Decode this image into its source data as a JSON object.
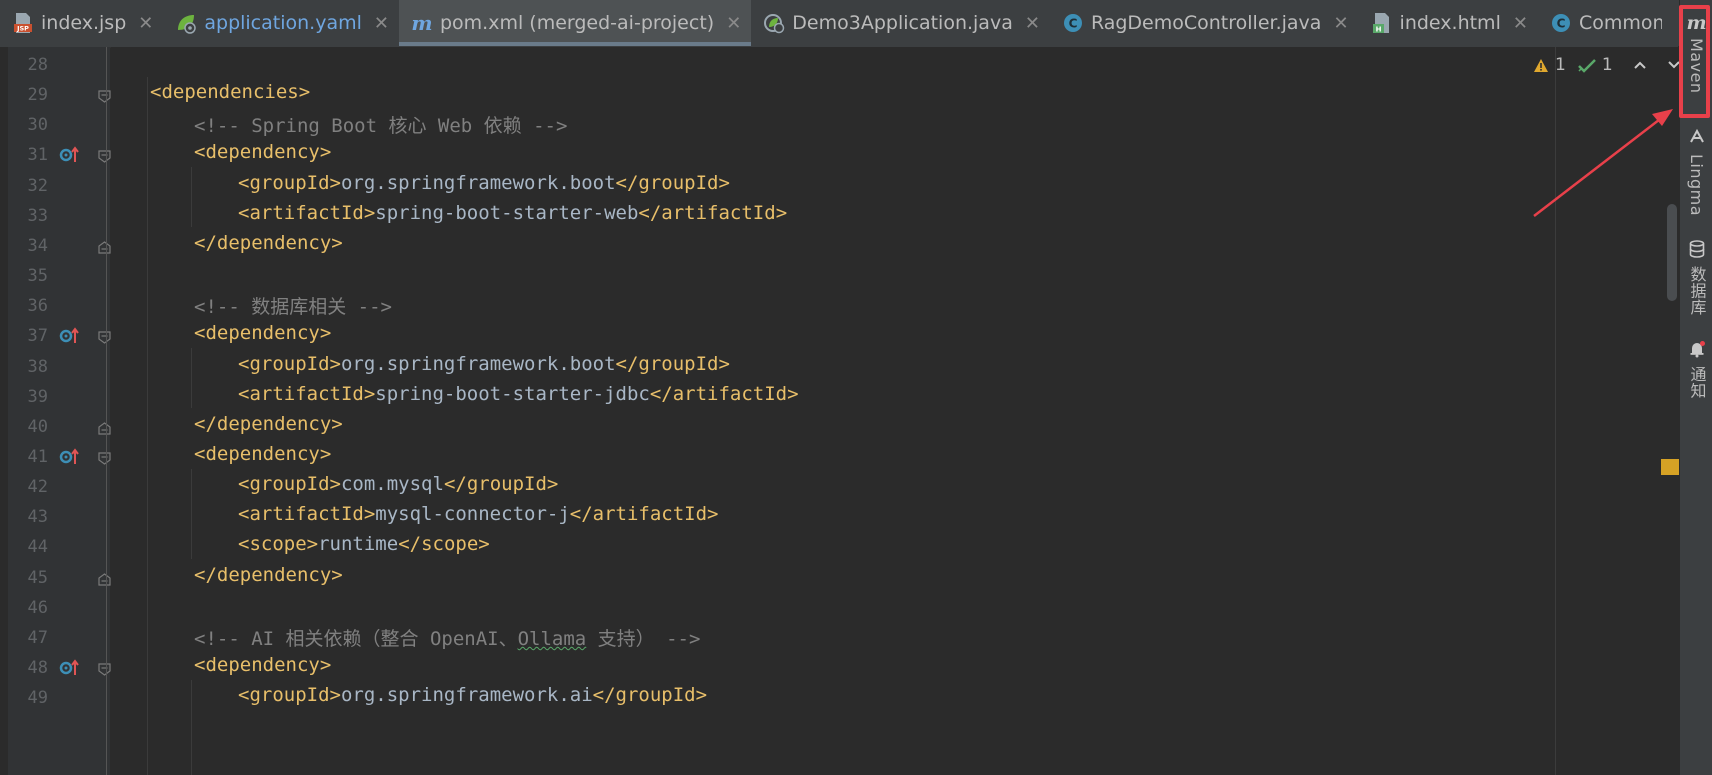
{
  "tabs": [
    {
      "label": "index.jsp",
      "icon": "jsp-file-icon",
      "active": false,
      "blue": false
    },
    {
      "label": "application.yaml",
      "icon": "spring-yaml-icon",
      "active": false,
      "blue": true
    },
    {
      "label": "pom.xml (merged-ai-project)",
      "icon": "maven-m-icon",
      "active": true,
      "blue": false
    },
    {
      "label": "Demo3Application.java",
      "icon": "spring-boot-app-icon",
      "active": false,
      "blue": false
    },
    {
      "label": "RagDemoController.java",
      "icon": "java-class-icon",
      "active": false,
      "blue": false
    },
    {
      "label": "index.html",
      "icon": "html-file-icon",
      "active": false,
      "blue": false
    },
    {
      "label": "CommonConf",
      "icon": "java-class-icon",
      "active": false,
      "blue": false
    }
  ],
  "tab_close_glyph": "✕",
  "tab_overflow_glyph": "⌄",
  "toolstrip": {
    "maven": "Maven",
    "lingma": "Lingma",
    "database": "数据库",
    "notifications": "通知"
  },
  "inspections": {
    "warnings": "1",
    "ok": "1"
  },
  "lines": [
    {
      "n": "28",
      "indent": 0,
      "kind": "blank",
      "text": ""
    },
    {
      "n": "29",
      "indent": 0,
      "kind": "open",
      "tag": "dependencies",
      "fold": "open"
    },
    {
      "n": "30",
      "indent": 1,
      "kind": "comment",
      "text": "<!-- Spring Boot 核心 Web 依赖 -->"
    },
    {
      "n": "31",
      "indent": 1,
      "kind": "open",
      "tag": "dependency",
      "fold": "open",
      "marker": true
    },
    {
      "n": "32",
      "indent": 2,
      "kind": "elem",
      "tag": "groupId",
      "text": "org.springframework.boot"
    },
    {
      "n": "33",
      "indent": 2,
      "kind": "elem",
      "tag": "artifactId",
      "text": "spring-boot-starter-web"
    },
    {
      "n": "34",
      "indent": 1,
      "kind": "close",
      "tag": "dependency",
      "fold": "close"
    },
    {
      "n": "35",
      "indent": 0,
      "kind": "blank",
      "text": ""
    },
    {
      "n": "36",
      "indent": 1,
      "kind": "comment",
      "text": "<!-- 数据库相关 -->"
    },
    {
      "n": "37",
      "indent": 1,
      "kind": "open",
      "tag": "dependency",
      "fold": "open",
      "marker": true
    },
    {
      "n": "38",
      "indent": 2,
      "kind": "elem",
      "tag": "groupId",
      "text": "org.springframework.boot"
    },
    {
      "n": "39",
      "indent": 2,
      "kind": "elem",
      "tag": "artifactId",
      "text": "spring-boot-starter-jdbc"
    },
    {
      "n": "40",
      "indent": 1,
      "kind": "close",
      "tag": "dependency",
      "fold": "close"
    },
    {
      "n": "41",
      "indent": 1,
      "kind": "open",
      "tag": "dependency",
      "fold": "open",
      "marker": true
    },
    {
      "n": "42",
      "indent": 2,
      "kind": "elem",
      "tag": "groupId",
      "text": "com.mysql"
    },
    {
      "n": "43",
      "indent": 2,
      "kind": "elem",
      "tag": "artifactId",
      "text": "mysql-connector-j"
    },
    {
      "n": "44",
      "indent": 2,
      "kind": "elem",
      "tag": "scope",
      "text": "runtime"
    },
    {
      "n": "45",
      "indent": 1,
      "kind": "close",
      "tag": "dependency",
      "fold": "close"
    },
    {
      "n": "46",
      "indent": 0,
      "kind": "blank",
      "text": ""
    },
    {
      "n": "47",
      "indent": 1,
      "kind": "comment",
      "pre": "<!-- AI 相关依赖（整合 OpenAI、",
      "squiggle": "Ollama",
      "post": " 支持） -->"
    },
    {
      "n": "48",
      "indent": 1,
      "kind": "open",
      "tag": "dependency",
      "fold": "open",
      "marker": true
    },
    {
      "n": "49",
      "indent": 2,
      "kind": "elem",
      "tag": "groupId",
      "text": "org.springframework.ai"
    }
  ],
  "colors": {
    "tag": "#e8bf6a",
    "text": "#a9b7c6",
    "comment": "#808080",
    "annotation_box": "#e8404a"
  }
}
